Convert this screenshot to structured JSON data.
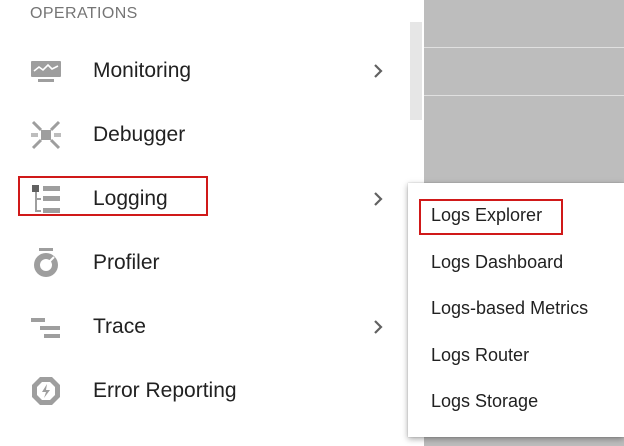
{
  "sidebar": {
    "section_header": "OPERATIONS",
    "items": [
      {
        "label": "Monitoring",
        "icon": "monitoring-icon",
        "has_submenu": true
      },
      {
        "label": "Debugger",
        "icon": "debugger-icon",
        "has_submenu": false
      },
      {
        "label": "Logging",
        "icon": "logging-icon",
        "has_submenu": true,
        "highlighted": true
      },
      {
        "label": "Profiler",
        "icon": "profiler-icon",
        "has_submenu": false
      },
      {
        "label": "Trace",
        "icon": "trace-icon",
        "has_submenu": true
      },
      {
        "label": "Error Reporting",
        "icon": "error-reporting-icon",
        "has_submenu": false
      }
    ]
  },
  "logging_submenu": {
    "items": [
      {
        "label": "Logs Explorer",
        "highlighted": true
      },
      {
        "label": "Logs Dashboard"
      },
      {
        "label": "Logs-based Metrics"
      },
      {
        "label": "Logs Router"
      },
      {
        "label": "Logs Storage"
      }
    ]
  },
  "colors": {
    "highlight_border": "#d01919",
    "icon_gray": "#9e9e9e",
    "text": "#212121",
    "header_text": "#757575"
  }
}
